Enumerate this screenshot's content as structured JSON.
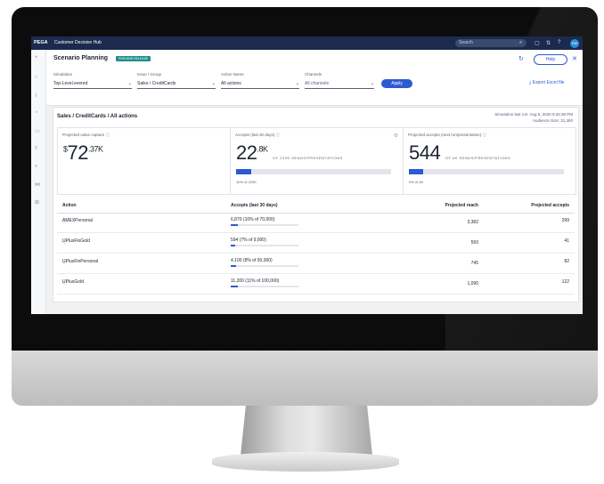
{
  "topbar": {
    "logo": "PEGA",
    "app_name": "Customer Decision Hub",
    "search_placeholder": "Search",
    "avatar": "RW"
  },
  "header": {
    "title": "Scenario Planning",
    "badge": "PREVIEW RELEASE",
    "help_label": "Help"
  },
  "filters": [
    {
      "label": "Simulation",
      "value": "Top-Level.evered"
    },
    {
      "label": "Issue / Group",
      "value": "Sales / CreditCards"
    },
    {
      "label": "Action Name",
      "value": "All actions"
    },
    {
      "label": "Channels",
      "value": "All channels"
    }
  ],
  "apply_label": "Apply",
  "export_label": "Export Excel file",
  "content": {
    "title": "Sales / CreditCards / All actions",
    "sim_run": "Simulation last run: Aug 5, 2020 9:25:38 PM",
    "audience": "Audience Size: 31,350"
  },
  "cards": [
    {
      "label": "Projected value capture",
      "prefix": "$",
      "value": "72",
      "decimal": ".37K"
    },
    {
      "label": "Accepts (last 30 days)",
      "value": "22",
      "decimal": ".8K",
      "of": "OF 229K SENDS/PRESENTATIONS",
      "bar_fraction": 0.1,
      "bar_note": "10% of 229K"
    },
    {
      "label": "Projected accepts (next run/presentation)",
      "value": "544",
      "of": "OF 6K SENDS/PRESENTATIONS",
      "bar_fraction": 0.09,
      "bar_note": "9% of 6K"
    }
  ],
  "table": {
    "headers": [
      "Action",
      "Accepts (last 30 days)",
      "Projected reach",
      "Projected accepts"
    ],
    "rows": [
      {
        "action": "AMEXPersonal",
        "accepts": "6,870 (10% of 70,000)",
        "fraction": 0.1,
        "reach": "3,382",
        "proj": "299"
      },
      {
        "action": "UPlusFinGold",
        "accepts": "594 (7% of 9,000)",
        "fraction": 0.07,
        "reach": "550",
        "proj": "41"
      },
      {
        "action": "UPlusFinPersonal",
        "accepts": "4,100 (8% of 50,000)",
        "fraction": 0.08,
        "reach": "745",
        "proj": "82"
      },
      {
        "action": "UPlusGold",
        "accepts": "11,200 (11% of 100,000)",
        "fraction": 0.11,
        "reach": "1,090",
        "proj": "122"
      }
    ]
  }
}
